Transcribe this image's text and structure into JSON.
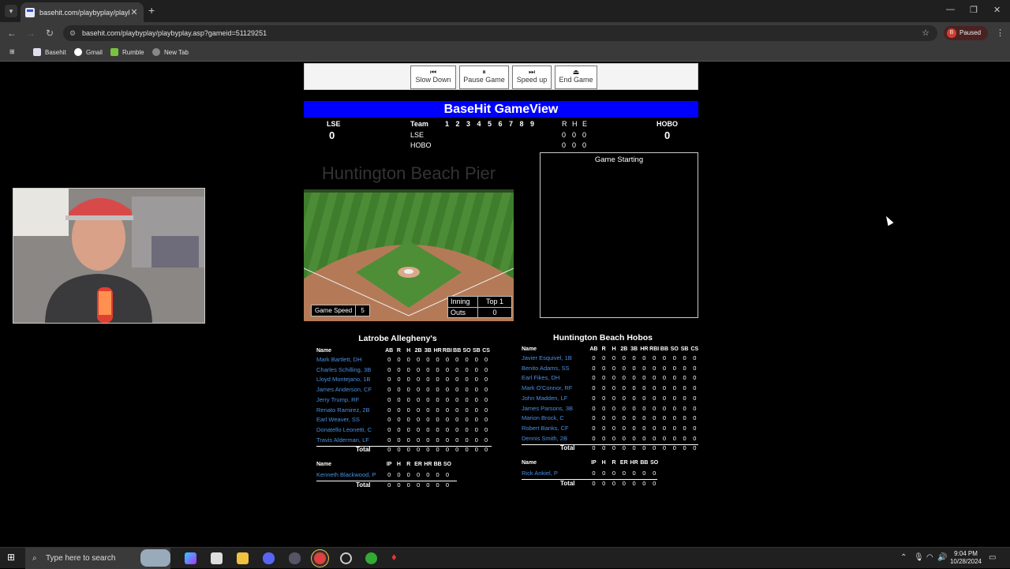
{
  "browser": {
    "tab_title": "basehit.com/playbyplay/playbyp",
    "url": "basehit.com/playbyplay/playbyplay.asp?gameid=51129251",
    "profile_initial": "B",
    "profile_status": "Paused",
    "bookmarks": [
      "Basehit",
      "Gmail",
      "Rumble",
      "New Tab"
    ]
  },
  "controls": {
    "slow_down": "Slow Down",
    "pause": "Pause Game",
    "speed_up": "Speed up",
    "end": "End Game"
  },
  "game": {
    "title": "BaseHit GameView",
    "away_abbr": "LSE",
    "home_abbr": "HOBO",
    "away_score": "0",
    "home_score": "0",
    "team_col": "Team",
    "innings": [
      "1",
      "2",
      "3",
      "4",
      "5",
      "6",
      "7",
      "8",
      "9"
    ],
    "rhe_labels": [
      "R",
      "H",
      "E"
    ],
    "away_rhe": [
      "0",
      "0",
      "0"
    ],
    "home_rhe": [
      "0",
      "0",
      "0"
    ],
    "stadium": "Huntington Beach Pier",
    "game_speed_label": "Game Speed",
    "game_speed": "5",
    "inning_label": "Inning",
    "inning_value": "Top 1",
    "outs_label": "Outs",
    "outs_value": "0",
    "log_header": "Game Starting"
  },
  "away_box": {
    "team": "Latrobe Allegheny's",
    "batting_cols": [
      "AB",
      "R",
      "H",
      "2B",
      "3B",
      "HR",
      "RBI",
      "BB",
      "SO",
      "SB",
      "CS"
    ],
    "batters": [
      "Mark Bartlett, DH",
      "Charles Schilling, 3B",
      "Lloyd Montejano, 1B",
      "James Anderson, CF",
      "Jerry Trump, RF",
      "Renato Ramirez, 2B",
      "Earl Weaver, SS",
      "Donatello Leonetti, C",
      "Travis Alderman, LF"
    ],
    "pitching_cols": [
      "IP",
      "H",
      "R",
      "ER",
      "HR",
      "BB",
      "SO"
    ],
    "pitchers": [
      "Kenneth Blackwood, P"
    ]
  },
  "home_box": {
    "team": "Huntington Beach Hobos",
    "batting_cols": [
      "AB",
      "R",
      "H",
      "2B",
      "3B",
      "HR",
      "RBI",
      "BB",
      "SO",
      "SB",
      "CS"
    ],
    "batters": [
      "Javier Esquivel, 1B",
      "Benito Adams, SS",
      "Earl Fikes, DH",
      "Mark O'Connor, RF",
      "John Madden, LF",
      "James Parsons, 3B",
      "Marion Brock, C",
      "Robert Banks, CF",
      "Dennis Smith, 2B"
    ],
    "pitching_cols": [
      "IP",
      "H",
      "R",
      "ER",
      "HR",
      "BB",
      "SO"
    ],
    "pitchers": [
      "Rick Ankiel, P"
    ]
  },
  "box_labels": {
    "name": "Name",
    "total": "Total",
    "zero": "0"
  },
  "taskbar": {
    "search_placeholder": "Type here to search",
    "time": "9:04 PM",
    "date": "10/28/2024"
  }
}
